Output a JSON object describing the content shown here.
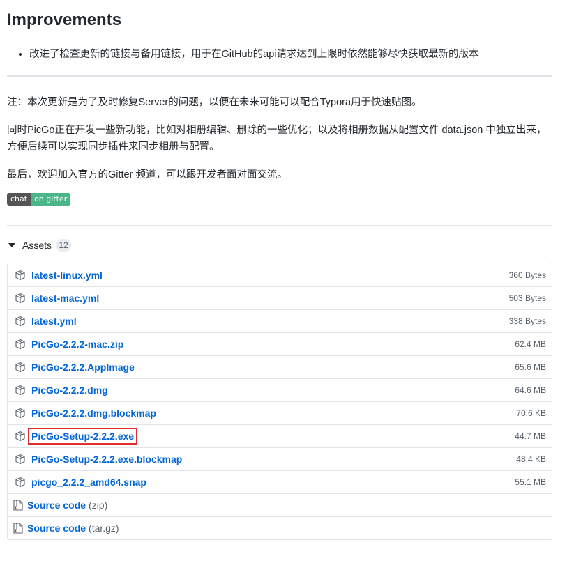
{
  "section": {
    "heading": "Improvements",
    "bullet": "改进了检查更新的链接与备用链接，用于在GitHub的api请求达到上限时依然能够尽快获取最新的版本"
  },
  "notes": {
    "p1": "注：本次更新是为了及时修复Server的问题，以便在未来可能可以配合Typora用于快速贴图。",
    "p2": "同时PicGo正在开发一些新功能，比如对相册编辑、删除的一些优化；以及将相册数据从配置文件 data.json 中独立出来，方便后续可以实现同步插件来同步相册与配置。",
    "p3": "最后，欢迎加入官方的Gitter 频道，可以跟开发者面对面交流。"
  },
  "badge": {
    "left": "chat",
    "right": "on gitter"
  },
  "assets": {
    "label": "Assets",
    "count": "12",
    "files": [
      {
        "name": "latest-linux.yml",
        "size": "360 Bytes"
      },
      {
        "name": "latest-mac.yml",
        "size": "503 Bytes"
      },
      {
        "name": "latest.yml",
        "size": "338 Bytes"
      },
      {
        "name": "PicGo-2.2.2-mac.zip",
        "size": "62.4 MB"
      },
      {
        "name": "PicGo-2.2.2.AppImage",
        "size": "65.6 MB"
      },
      {
        "name": "PicGo-2.2.2.dmg",
        "size": "64.6 MB"
      },
      {
        "name": "PicGo-2.2.2.dmg.blockmap",
        "size": "70.6 KB"
      },
      {
        "name": "PicGo-Setup-2.2.2.exe",
        "size": "44.7 MB"
      },
      {
        "name": "PicGo-Setup-2.2.2.exe.blockmap",
        "size": "48.4 KB"
      },
      {
        "name": "picgo_2.2.2_amd64.snap",
        "size": "55.1 MB"
      }
    ],
    "source": [
      {
        "label": "Source code",
        "ext": "(zip)"
      },
      {
        "label": "Source code",
        "ext": "(tar.gz)"
      }
    ]
  },
  "colors": {
    "link": "#0366d6",
    "highlight_box": "#e02e2e",
    "badge_right": "#4bb68a"
  },
  "icons": {
    "file": "package-icon",
    "source": "file-zip-icon",
    "toggle": "triangle-down-icon"
  }
}
